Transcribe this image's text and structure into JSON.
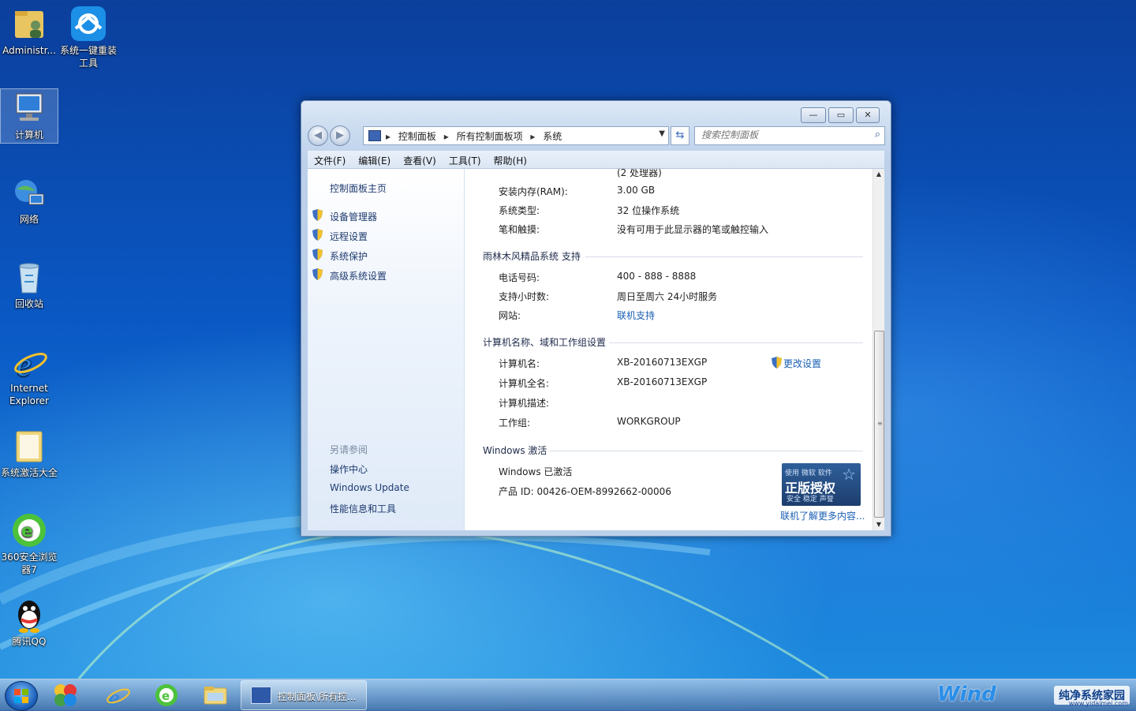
{
  "desktop": {
    "icons": [
      {
        "label": "Administr...",
        "icon": "user-folder-icon"
      },
      {
        "label": "系统一键重装工具",
        "icon": "reinstall-tool-icon"
      },
      {
        "label": "计算机",
        "icon": "computer-icon"
      },
      {
        "label": "网络",
        "icon": "network-icon"
      },
      {
        "label": "回收站",
        "icon": "recycle-bin-icon"
      },
      {
        "label": "Internet Explorer",
        "icon": "ie-icon"
      },
      {
        "label": "系统激活大全",
        "icon": "folder-icon"
      },
      {
        "label": "360安全浏览器7",
        "icon": "360-browser-icon"
      },
      {
        "label": "腾讯QQ",
        "icon": "qq-icon"
      }
    ]
  },
  "window": {
    "breadcrumbs": [
      "控制面板",
      "所有控制面板项",
      "系统"
    ],
    "search_placeholder": "搜索控制面板",
    "menu": [
      "文件(F)",
      "编辑(E)",
      "查看(V)",
      "工具(T)",
      "帮助(H)"
    ],
    "left": {
      "home": "控制面板主页",
      "links": [
        "设备管理器",
        "远程设置",
        "系统保护",
        "高级系统设置"
      ],
      "see_also_title": "另请参阅",
      "see_also": [
        "操作中心",
        "Windows Update",
        "性能信息和工具"
      ]
    },
    "system": {
      "cut_line": "(2 处理器)",
      "rows": [
        {
          "k": "安装内存(RAM):",
          "v": "3.00 GB"
        },
        {
          "k": "系统类型:",
          "v": "32 位操作系统"
        },
        {
          "k": "笔和触摸:",
          "v": "没有可用于此显示器的笔或触控输入"
        }
      ]
    },
    "support": {
      "title": "雨林木风精品系统 支持",
      "rows": [
        {
          "k": "电话号码:",
          "v": "400 - 888 - 8888"
        },
        {
          "k": "支持小时数:",
          "v": "周日至周六  24小时服务"
        },
        {
          "k": "网站:",
          "v": "联机支持"
        }
      ]
    },
    "computer": {
      "title": "计算机名称、域和工作组设置",
      "change": "更改设置",
      "rows": [
        {
          "k": "计算机名:",
          "v": "XB-20160713EXGP"
        },
        {
          "k": "计算机全名:",
          "v": "XB-20160713EXGP"
        },
        {
          "k": "计算机描述:",
          "v": ""
        },
        {
          "k": "工作组:",
          "v": "WORKGROUP"
        }
      ]
    },
    "activation": {
      "title": "Windows 激活",
      "status": "Windows 已激活",
      "product_id": "产品 ID: 00426-OEM-8992662-00006",
      "badge_top": "使用 微软 软件",
      "badge_main": "正版授权",
      "badge_sub": "安全 稳定 声誉",
      "more": "联机了解更多内容..."
    }
  },
  "taskbar": {
    "task_label": "控制面板\\所有控...",
    "tray_logo": "纯净系统家园",
    "tray_url": "www.yidaimei.com",
    "win_text": "Wind"
  },
  "colors": {
    "link": "#1a5fb4",
    "desktop": "#0a58c4",
    "accent": "#2a8ee8"
  }
}
